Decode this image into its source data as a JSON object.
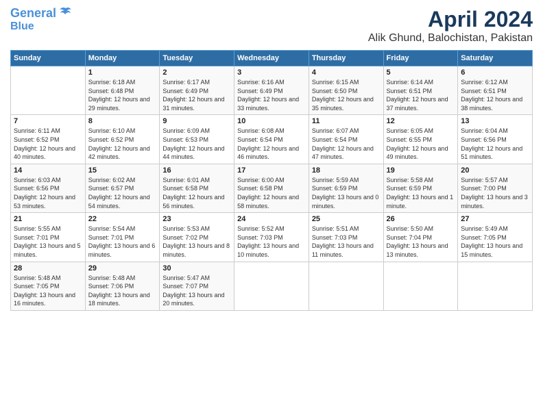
{
  "logo": {
    "line1": "General",
    "line2": "Blue"
  },
  "title": "April 2024",
  "subtitle": "Alik Ghund, Balochistan, Pakistan",
  "days_header": [
    "Sunday",
    "Monday",
    "Tuesday",
    "Wednesday",
    "Thursday",
    "Friday",
    "Saturday"
  ],
  "weeks": [
    [
      {
        "num": "",
        "sunrise": "",
        "sunset": "",
        "daylight": ""
      },
      {
        "num": "1",
        "sunrise": "Sunrise: 6:18 AM",
        "sunset": "Sunset: 6:48 PM",
        "daylight": "Daylight: 12 hours and 29 minutes."
      },
      {
        "num": "2",
        "sunrise": "Sunrise: 6:17 AM",
        "sunset": "Sunset: 6:49 PM",
        "daylight": "Daylight: 12 hours and 31 minutes."
      },
      {
        "num": "3",
        "sunrise": "Sunrise: 6:16 AM",
        "sunset": "Sunset: 6:49 PM",
        "daylight": "Daylight: 12 hours and 33 minutes."
      },
      {
        "num": "4",
        "sunrise": "Sunrise: 6:15 AM",
        "sunset": "Sunset: 6:50 PM",
        "daylight": "Daylight: 12 hours and 35 minutes."
      },
      {
        "num": "5",
        "sunrise": "Sunrise: 6:14 AM",
        "sunset": "Sunset: 6:51 PM",
        "daylight": "Daylight: 12 hours and 37 minutes."
      },
      {
        "num": "6",
        "sunrise": "Sunrise: 6:12 AM",
        "sunset": "Sunset: 6:51 PM",
        "daylight": "Daylight: 12 hours and 38 minutes."
      }
    ],
    [
      {
        "num": "7",
        "sunrise": "Sunrise: 6:11 AM",
        "sunset": "Sunset: 6:52 PM",
        "daylight": "Daylight: 12 hours and 40 minutes."
      },
      {
        "num": "8",
        "sunrise": "Sunrise: 6:10 AM",
        "sunset": "Sunset: 6:52 PM",
        "daylight": "Daylight: 12 hours and 42 minutes."
      },
      {
        "num": "9",
        "sunrise": "Sunrise: 6:09 AM",
        "sunset": "Sunset: 6:53 PM",
        "daylight": "Daylight: 12 hours and 44 minutes."
      },
      {
        "num": "10",
        "sunrise": "Sunrise: 6:08 AM",
        "sunset": "Sunset: 6:54 PM",
        "daylight": "Daylight: 12 hours and 46 minutes."
      },
      {
        "num": "11",
        "sunrise": "Sunrise: 6:07 AM",
        "sunset": "Sunset: 6:54 PM",
        "daylight": "Daylight: 12 hours and 47 minutes."
      },
      {
        "num": "12",
        "sunrise": "Sunrise: 6:05 AM",
        "sunset": "Sunset: 6:55 PM",
        "daylight": "Daylight: 12 hours and 49 minutes."
      },
      {
        "num": "13",
        "sunrise": "Sunrise: 6:04 AM",
        "sunset": "Sunset: 6:56 PM",
        "daylight": "Daylight: 12 hours and 51 minutes."
      }
    ],
    [
      {
        "num": "14",
        "sunrise": "Sunrise: 6:03 AM",
        "sunset": "Sunset: 6:56 PM",
        "daylight": "Daylight: 12 hours and 53 minutes."
      },
      {
        "num": "15",
        "sunrise": "Sunrise: 6:02 AM",
        "sunset": "Sunset: 6:57 PM",
        "daylight": "Daylight: 12 hours and 54 minutes."
      },
      {
        "num": "16",
        "sunrise": "Sunrise: 6:01 AM",
        "sunset": "Sunset: 6:58 PM",
        "daylight": "Daylight: 12 hours and 56 minutes."
      },
      {
        "num": "17",
        "sunrise": "Sunrise: 6:00 AM",
        "sunset": "Sunset: 6:58 PM",
        "daylight": "Daylight: 12 hours and 58 minutes."
      },
      {
        "num": "18",
        "sunrise": "Sunrise: 5:59 AM",
        "sunset": "Sunset: 6:59 PM",
        "daylight": "Daylight: 13 hours and 0 minutes."
      },
      {
        "num": "19",
        "sunrise": "Sunrise: 5:58 AM",
        "sunset": "Sunset: 6:59 PM",
        "daylight": "Daylight: 13 hours and 1 minute."
      },
      {
        "num": "20",
        "sunrise": "Sunrise: 5:57 AM",
        "sunset": "Sunset: 7:00 PM",
        "daylight": "Daylight: 13 hours and 3 minutes."
      }
    ],
    [
      {
        "num": "21",
        "sunrise": "Sunrise: 5:55 AM",
        "sunset": "Sunset: 7:01 PM",
        "daylight": "Daylight: 13 hours and 5 minutes."
      },
      {
        "num": "22",
        "sunrise": "Sunrise: 5:54 AM",
        "sunset": "Sunset: 7:01 PM",
        "daylight": "Daylight: 13 hours and 6 minutes."
      },
      {
        "num": "23",
        "sunrise": "Sunrise: 5:53 AM",
        "sunset": "Sunset: 7:02 PM",
        "daylight": "Daylight: 13 hours and 8 minutes."
      },
      {
        "num": "24",
        "sunrise": "Sunrise: 5:52 AM",
        "sunset": "Sunset: 7:03 PM",
        "daylight": "Daylight: 13 hours and 10 minutes."
      },
      {
        "num": "25",
        "sunrise": "Sunrise: 5:51 AM",
        "sunset": "Sunset: 7:03 PM",
        "daylight": "Daylight: 13 hours and 11 minutes."
      },
      {
        "num": "26",
        "sunrise": "Sunrise: 5:50 AM",
        "sunset": "Sunset: 7:04 PM",
        "daylight": "Daylight: 13 hours and 13 minutes."
      },
      {
        "num": "27",
        "sunrise": "Sunrise: 5:49 AM",
        "sunset": "Sunset: 7:05 PM",
        "daylight": "Daylight: 13 hours and 15 minutes."
      }
    ],
    [
      {
        "num": "28",
        "sunrise": "Sunrise: 5:48 AM",
        "sunset": "Sunset: 7:05 PM",
        "daylight": "Daylight: 13 hours and 16 minutes."
      },
      {
        "num": "29",
        "sunrise": "Sunrise: 5:48 AM",
        "sunset": "Sunset: 7:06 PM",
        "daylight": "Daylight: 13 hours and 18 minutes."
      },
      {
        "num": "30",
        "sunrise": "Sunrise: 5:47 AM",
        "sunset": "Sunset: 7:07 PM",
        "daylight": "Daylight: 13 hours and 20 minutes."
      },
      {
        "num": "",
        "sunrise": "",
        "sunset": "",
        "daylight": ""
      },
      {
        "num": "",
        "sunrise": "",
        "sunset": "",
        "daylight": ""
      },
      {
        "num": "",
        "sunrise": "",
        "sunset": "",
        "daylight": ""
      },
      {
        "num": "",
        "sunrise": "",
        "sunset": "",
        "daylight": ""
      }
    ]
  ]
}
